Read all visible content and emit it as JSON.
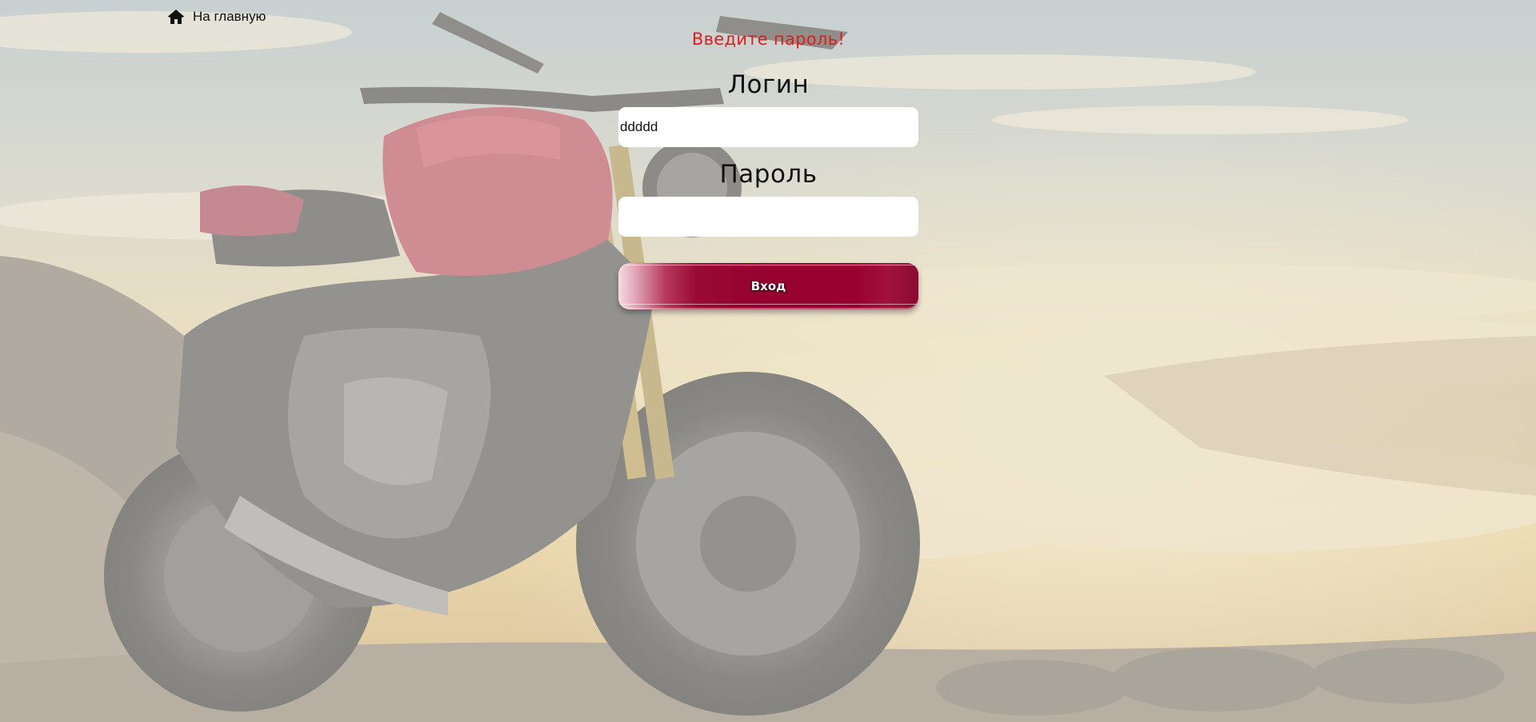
{
  "page": {
    "background": "motorcycle-on-mountain-at-sunset-photo"
  },
  "nav": {
    "home_icon": "home-icon",
    "home_label": "На главную"
  },
  "form": {
    "error_message": "Введите пароль!",
    "error_color": "#e31b1b",
    "login_label": "Логин",
    "login_value": "ddddd",
    "password_label": "Пароль",
    "password_value": "",
    "submit_label": "Вход",
    "submit_color": "#970031"
  }
}
